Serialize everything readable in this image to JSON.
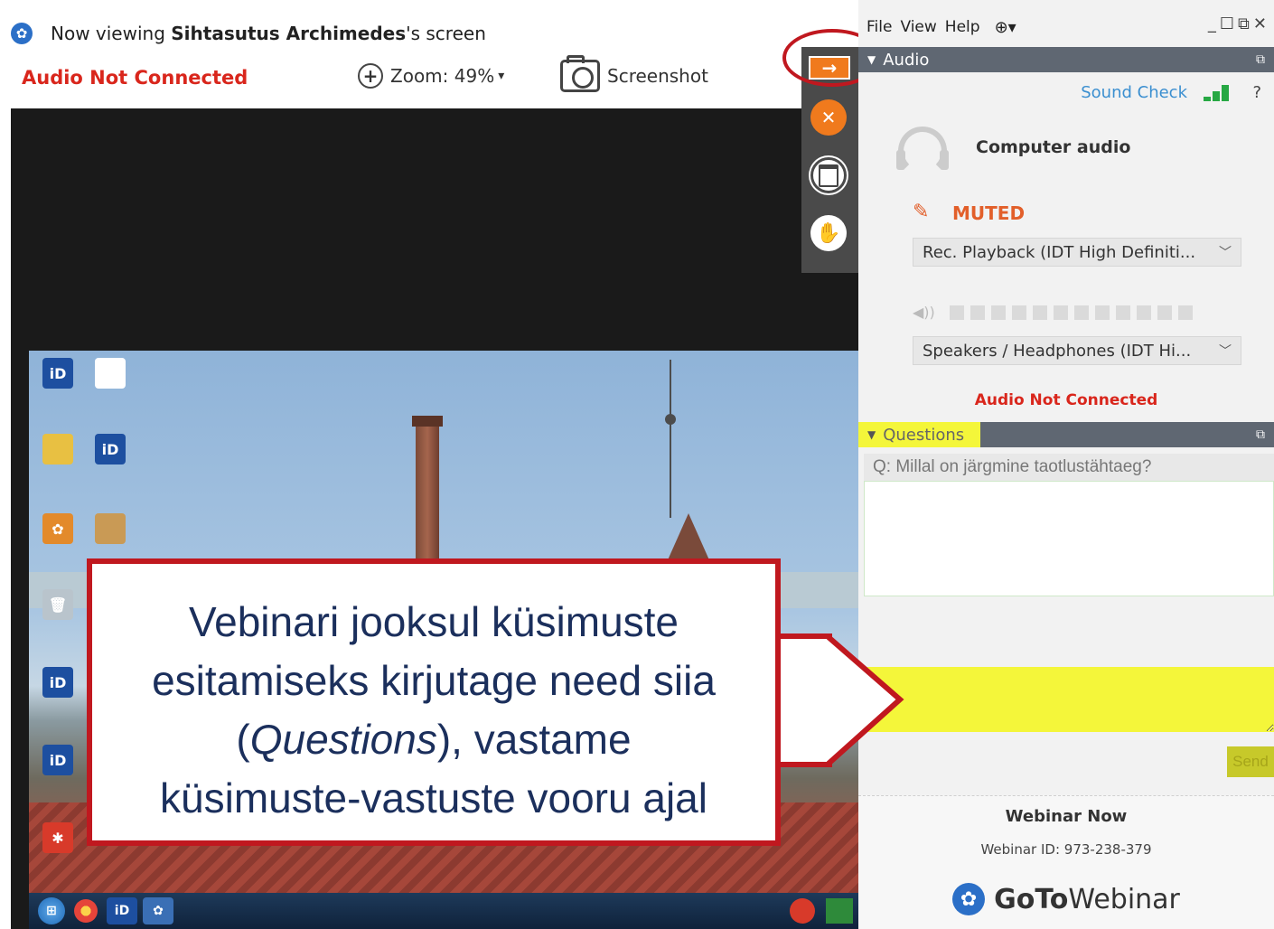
{
  "viewer": {
    "title_prefix": "Now viewing ",
    "presenter": "Sihtasutus Archimedes",
    "title_suffix": "'s screen",
    "audio_status": "Audio Not Connected",
    "zoom_label": "Zoom: 49%",
    "zoom_caret": "▾",
    "screenshot_label": "Screenshot"
  },
  "side_strip": {
    "collapse_icon": "arrow-right-icon",
    "mute_icon": "mic-muted-icon",
    "window_icon": "window-icon",
    "hand_icon": "raise-hand-icon"
  },
  "panel": {
    "menu": [
      "File",
      "View",
      "Help"
    ],
    "audio_header": "Audio",
    "sound_check": "Sound Check",
    "help": "?",
    "computer_audio": "Computer audio",
    "muted": "MUTED",
    "mic_device": "Rec. Playback (IDT High Definiti...",
    "speaker_device": "Speakers / Headphones (IDT Hi...",
    "audio_status": "Audio Not Connected",
    "questions_header": "Questions",
    "question": "Q: Millal on järgmine taotlustähtaeg?",
    "question_input_value": "",
    "send_label": "Send",
    "webinar_now": "Webinar Now",
    "webinar_id": "Webinar ID: 973-238-379",
    "brand_goto": "GoTo",
    "brand_webinar": "Webinar"
  },
  "desktop_icons": [
    "iD",
    "iD",
    "iD",
    "iD"
  ],
  "callout": {
    "line1": "Vebinari jooksul küsimuste",
    "line2": "esitamiseks kirjutage need siia",
    "line3_open": "(",
    "line3_italic": "Questions",
    "line3_close": "), vastame",
    "line4": "küsimuste-vastuste vooru ajal"
  },
  "colors": {
    "accent_red": "#c0181f",
    "status_red": "#d9261c",
    "orange": "#f07a1d",
    "highlight_yellow": "#f4f63a",
    "callout_text": "#1b2f5c"
  }
}
